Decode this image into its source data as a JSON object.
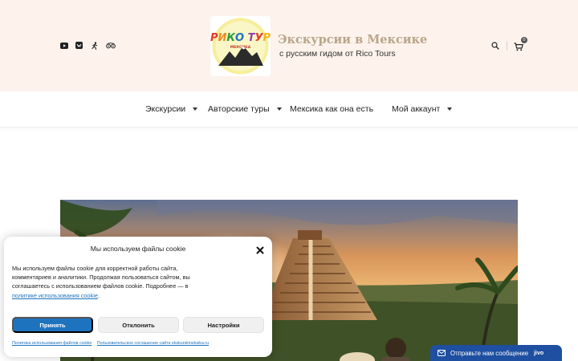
{
  "header": {
    "social_icons": [
      "youtube-icon",
      "vk-icon",
      "tripster-icon",
      "tripadvisor-icon"
    ],
    "logo_text": "РИКО ТУР",
    "logo_sub": "МЕКСИКА",
    "title": "Экскурсии в Мексике",
    "subtitle": "с русским гидом от Rico Tours",
    "cart_count": "0"
  },
  "nav": {
    "items": [
      {
        "label": "Экскурсии",
        "dropdown": true
      },
      {
        "label": "Авторские туры",
        "dropdown": true
      },
      {
        "label": "Мексика как она есть",
        "dropdown": false
      },
      {
        "label": "Мой аккаунт",
        "dropdown": true
      }
    ]
  },
  "cookie": {
    "title": "Мы используем файлы cookie",
    "text": "Мы используем файлы cookie для корректной работы сайта, комментариев и аналитики. Продолжая пользоваться сайтом, вы соглашаетесь с использованием файлов cookie. Подробнее — в",
    "policy_link": "политике использования cookie",
    "accept": "Принять",
    "deny": "Отклонить",
    "preferences": "Настройки",
    "footer_link_1": "Политика использования файлов cookie",
    "footer_link_2": "Пользовательское соглашение сайта ekskursiimeksika.ru"
  },
  "chat": {
    "label": "Отправьте нам сообщение",
    "brand": "jivo"
  },
  "colors": {
    "header_bg": "#fdf3ec",
    "accent": "#1e73be",
    "chat_bg": "#1e4fa0",
    "title_color": "#b9a58a"
  }
}
